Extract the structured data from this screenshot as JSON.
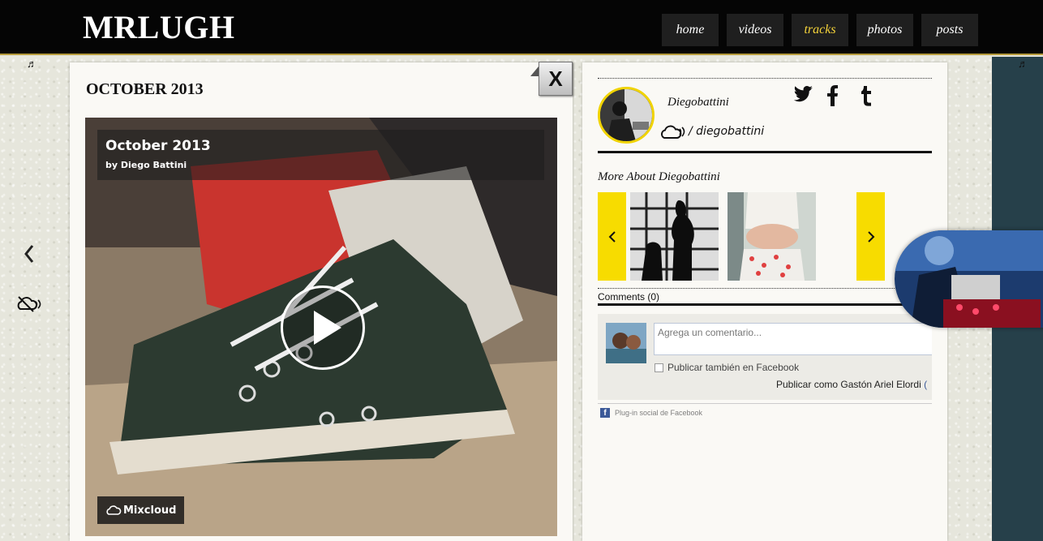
{
  "site": {
    "logo": "MRLUGH"
  },
  "nav": {
    "items": [
      {
        "label": "home",
        "active": false
      },
      {
        "label": "videos",
        "active": false
      },
      {
        "label": "tracks",
        "active": true
      },
      {
        "label": "photos",
        "active": false
      },
      {
        "label": "posts",
        "active": false
      }
    ]
  },
  "content": {
    "title": "OCTOBER 2013",
    "close_label": "X"
  },
  "player": {
    "title": "October 2013",
    "byline": "by Diego Battini",
    "badge": "Mixcloud"
  },
  "profile": {
    "name": "Diegobattini",
    "handle": "/ diegobattini",
    "more_about": "More About Diegobattini",
    "comments_label": "Comments (0)"
  },
  "comment_widget": {
    "placeholder": "Agrega un comentario...",
    "checkbox_label": "Publicar también en Facebook",
    "post_as": "Publicar como Gastón Ariel Elordi",
    "post_as_tail": "(",
    "plugin_label": "Plug-in social de Facebook"
  },
  "colors": {
    "accent": "#f7dc00",
    "nav_active": "#f5d33a",
    "topbar": "#050505",
    "right_panel": "#26404a"
  }
}
